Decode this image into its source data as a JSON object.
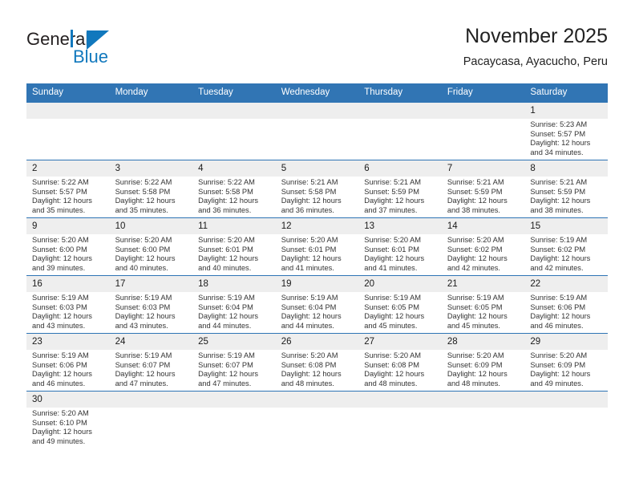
{
  "logo": {
    "word1": "General",
    "word2": "Blue",
    "icon": "triangle-logo-mark",
    "brand_color": "#1178bd"
  },
  "header": {
    "title": "November 2025",
    "subtitle": "Pacaycasa, Ayacucho, Peru"
  },
  "theme": {
    "header_bg": "#3175b4",
    "row_divider": "#2e74b5",
    "daynum_bg": "#eeeeee",
    "text": "#333333"
  },
  "weekdays": [
    "Sunday",
    "Monday",
    "Tuesday",
    "Wednesday",
    "Thursday",
    "Friday",
    "Saturday"
  ],
  "labels": {
    "sunrise": "Sunrise:",
    "sunset": "Sunset:",
    "daylight": "Daylight:"
  },
  "weeks": [
    [
      {
        "day": "",
        "sunrise": "",
        "sunset": "",
        "daylight1": "",
        "daylight2": ""
      },
      {
        "day": "",
        "sunrise": "",
        "sunset": "",
        "daylight1": "",
        "daylight2": ""
      },
      {
        "day": "",
        "sunrise": "",
        "sunset": "",
        "daylight1": "",
        "daylight2": ""
      },
      {
        "day": "",
        "sunrise": "",
        "sunset": "",
        "daylight1": "",
        "daylight2": ""
      },
      {
        "day": "",
        "sunrise": "",
        "sunset": "",
        "daylight1": "",
        "daylight2": ""
      },
      {
        "day": "",
        "sunrise": "",
        "sunset": "",
        "daylight1": "",
        "daylight2": ""
      },
      {
        "day": "1",
        "sunrise": "Sunrise: 5:23 AM",
        "sunset": "Sunset: 5:57 PM",
        "daylight1": "Daylight: 12 hours",
        "daylight2": "and 34 minutes."
      }
    ],
    [
      {
        "day": "2",
        "sunrise": "Sunrise: 5:22 AM",
        "sunset": "Sunset: 5:57 PM",
        "daylight1": "Daylight: 12 hours",
        "daylight2": "and 35 minutes."
      },
      {
        "day": "3",
        "sunrise": "Sunrise: 5:22 AM",
        "sunset": "Sunset: 5:58 PM",
        "daylight1": "Daylight: 12 hours",
        "daylight2": "and 35 minutes."
      },
      {
        "day": "4",
        "sunrise": "Sunrise: 5:22 AM",
        "sunset": "Sunset: 5:58 PM",
        "daylight1": "Daylight: 12 hours",
        "daylight2": "and 36 minutes."
      },
      {
        "day": "5",
        "sunrise": "Sunrise: 5:21 AM",
        "sunset": "Sunset: 5:58 PM",
        "daylight1": "Daylight: 12 hours",
        "daylight2": "and 36 minutes."
      },
      {
        "day": "6",
        "sunrise": "Sunrise: 5:21 AM",
        "sunset": "Sunset: 5:59 PM",
        "daylight1": "Daylight: 12 hours",
        "daylight2": "and 37 minutes."
      },
      {
        "day": "7",
        "sunrise": "Sunrise: 5:21 AM",
        "sunset": "Sunset: 5:59 PM",
        "daylight1": "Daylight: 12 hours",
        "daylight2": "and 38 minutes."
      },
      {
        "day": "8",
        "sunrise": "Sunrise: 5:21 AM",
        "sunset": "Sunset: 5:59 PM",
        "daylight1": "Daylight: 12 hours",
        "daylight2": "and 38 minutes."
      }
    ],
    [
      {
        "day": "9",
        "sunrise": "Sunrise: 5:20 AM",
        "sunset": "Sunset: 6:00 PM",
        "daylight1": "Daylight: 12 hours",
        "daylight2": "and 39 minutes."
      },
      {
        "day": "10",
        "sunrise": "Sunrise: 5:20 AM",
        "sunset": "Sunset: 6:00 PM",
        "daylight1": "Daylight: 12 hours",
        "daylight2": "and 40 minutes."
      },
      {
        "day": "11",
        "sunrise": "Sunrise: 5:20 AM",
        "sunset": "Sunset: 6:01 PM",
        "daylight1": "Daylight: 12 hours",
        "daylight2": "and 40 minutes."
      },
      {
        "day": "12",
        "sunrise": "Sunrise: 5:20 AM",
        "sunset": "Sunset: 6:01 PM",
        "daylight1": "Daylight: 12 hours",
        "daylight2": "and 41 minutes."
      },
      {
        "day": "13",
        "sunrise": "Sunrise: 5:20 AM",
        "sunset": "Sunset: 6:01 PM",
        "daylight1": "Daylight: 12 hours",
        "daylight2": "and 41 minutes."
      },
      {
        "day": "14",
        "sunrise": "Sunrise: 5:20 AM",
        "sunset": "Sunset: 6:02 PM",
        "daylight1": "Daylight: 12 hours",
        "daylight2": "and 42 minutes."
      },
      {
        "day": "15",
        "sunrise": "Sunrise: 5:19 AM",
        "sunset": "Sunset: 6:02 PM",
        "daylight1": "Daylight: 12 hours",
        "daylight2": "and 42 minutes."
      }
    ],
    [
      {
        "day": "16",
        "sunrise": "Sunrise: 5:19 AM",
        "sunset": "Sunset: 6:03 PM",
        "daylight1": "Daylight: 12 hours",
        "daylight2": "and 43 minutes."
      },
      {
        "day": "17",
        "sunrise": "Sunrise: 5:19 AM",
        "sunset": "Sunset: 6:03 PM",
        "daylight1": "Daylight: 12 hours",
        "daylight2": "and 43 minutes."
      },
      {
        "day": "18",
        "sunrise": "Sunrise: 5:19 AM",
        "sunset": "Sunset: 6:04 PM",
        "daylight1": "Daylight: 12 hours",
        "daylight2": "and 44 minutes."
      },
      {
        "day": "19",
        "sunrise": "Sunrise: 5:19 AM",
        "sunset": "Sunset: 6:04 PM",
        "daylight1": "Daylight: 12 hours",
        "daylight2": "and 44 minutes."
      },
      {
        "day": "20",
        "sunrise": "Sunrise: 5:19 AM",
        "sunset": "Sunset: 6:05 PM",
        "daylight1": "Daylight: 12 hours",
        "daylight2": "and 45 minutes."
      },
      {
        "day": "21",
        "sunrise": "Sunrise: 5:19 AM",
        "sunset": "Sunset: 6:05 PM",
        "daylight1": "Daylight: 12 hours",
        "daylight2": "and 45 minutes."
      },
      {
        "day": "22",
        "sunrise": "Sunrise: 5:19 AM",
        "sunset": "Sunset: 6:06 PM",
        "daylight1": "Daylight: 12 hours",
        "daylight2": "and 46 minutes."
      }
    ],
    [
      {
        "day": "23",
        "sunrise": "Sunrise: 5:19 AM",
        "sunset": "Sunset: 6:06 PM",
        "daylight1": "Daylight: 12 hours",
        "daylight2": "and 46 minutes."
      },
      {
        "day": "24",
        "sunrise": "Sunrise: 5:19 AM",
        "sunset": "Sunset: 6:07 PM",
        "daylight1": "Daylight: 12 hours",
        "daylight2": "and 47 minutes."
      },
      {
        "day": "25",
        "sunrise": "Sunrise: 5:19 AM",
        "sunset": "Sunset: 6:07 PM",
        "daylight1": "Daylight: 12 hours",
        "daylight2": "and 47 minutes."
      },
      {
        "day": "26",
        "sunrise": "Sunrise: 5:20 AM",
        "sunset": "Sunset: 6:08 PM",
        "daylight1": "Daylight: 12 hours",
        "daylight2": "and 48 minutes."
      },
      {
        "day": "27",
        "sunrise": "Sunrise: 5:20 AM",
        "sunset": "Sunset: 6:08 PM",
        "daylight1": "Daylight: 12 hours",
        "daylight2": "and 48 minutes."
      },
      {
        "day": "28",
        "sunrise": "Sunrise: 5:20 AM",
        "sunset": "Sunset: 6:09 PM",
        "daylight1": "Daylight: 12 hours",
        "daylight2": "and 48 minutes."
      },
      {
        "day": "29",
        "sunrise": "Sunrise: 5:20 AM",
        "sunset": "Sunset: 6:09 PM",
        "daylight1": "Daylight: 12 hours",
        "daylight2": "and 49 minutes."
      }
    ],
    [
      {
        "day": "30",
        "sunrise": "Sunrise: 5:20 AM",
        "sunset": "Sunset: 6:10 PM",
        "daylight1": "Daylight: 12 hours",
        "daylight2": "and 49 minutes."
      },
      {
        "day": "",
        "sunrise": "",
        "sunset": "",
        "daylight1": "",
        "daylight2": ""
      },
      {
        "day": "",
        "sunrise": "",
        "sunset": "",
        "daylight1": "",
        "daylight2": ""
      },
      {
        "day": "",
        "sunrise": "",
        "sunset": "",
        "daylight1": "",
        "daylight2": ""
      },
      {
        "day": "",
        "sunrise": "",
        "sunset": "",
        "daylight1": "",
        "daylight2": ""
      },
      {
        "day": "",
        "sunrise": "",
        "sunset": "",
        "daylight1": "",
        "daylight2": ""
      },
      {
        "day": "",
        "sunrise": "",
        "sunset": "",
        "daylight1": "",
        "daylight2": ""
      }
    ]
  ]
}
